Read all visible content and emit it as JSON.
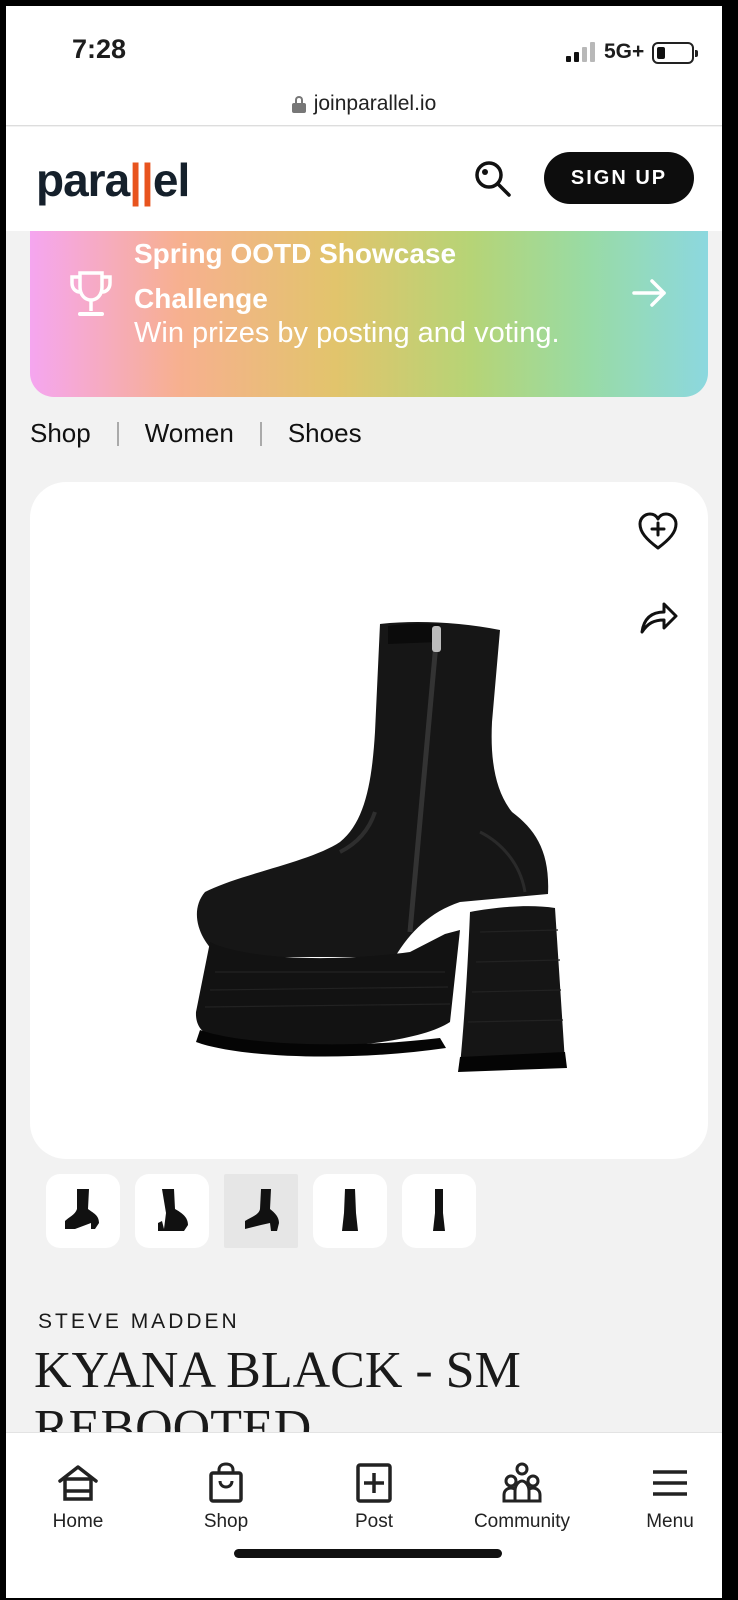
{
  "status_bar": {
    "time": "7:28",
    "network": "5G+"
  },
  "browser": {
    "url": "joinparallel.io"
  },
  "header": {
    "logo_text_pre": "para",
    "logo_bars": "||",
    "logo_text_post": "el",
    "signup_label": "SIGN UP"
  },
  "banner": {
    "title": "Spring OOTD Showcase Challenge",
    "subtitle": "Win prizes by posting and voting."
  },
  "breadcrumb": [
    "Shop",
    "Women",
    "Shoes"
  ],
  "product": {
    "brand": "STEVE MADDEN",
    "name": "KYANA BLACK - SM REBOOTED",
    "thumbnail_count": 5,
    "active_thumbnail": 3
  },
  "bottom_nav": [
    {
      "label": "Home",
      "icon": "home-icon"
    },
    {
      "label": "Shop",
      "icon": "shopping-bag-icon"
    },
    {
      "label": "Post",
      "icon": "plus-square-icon"
    },
    {
      "label": "Community",
      "icon": "community-icon"
    },
    {
      "label": "Menu",
      "icon": "hamburger-menu-icon"
    }
  ],
  "colors": {
    "brand_orange": "#e8541e",
    "dark": "#0d0d0d"
  }
}
